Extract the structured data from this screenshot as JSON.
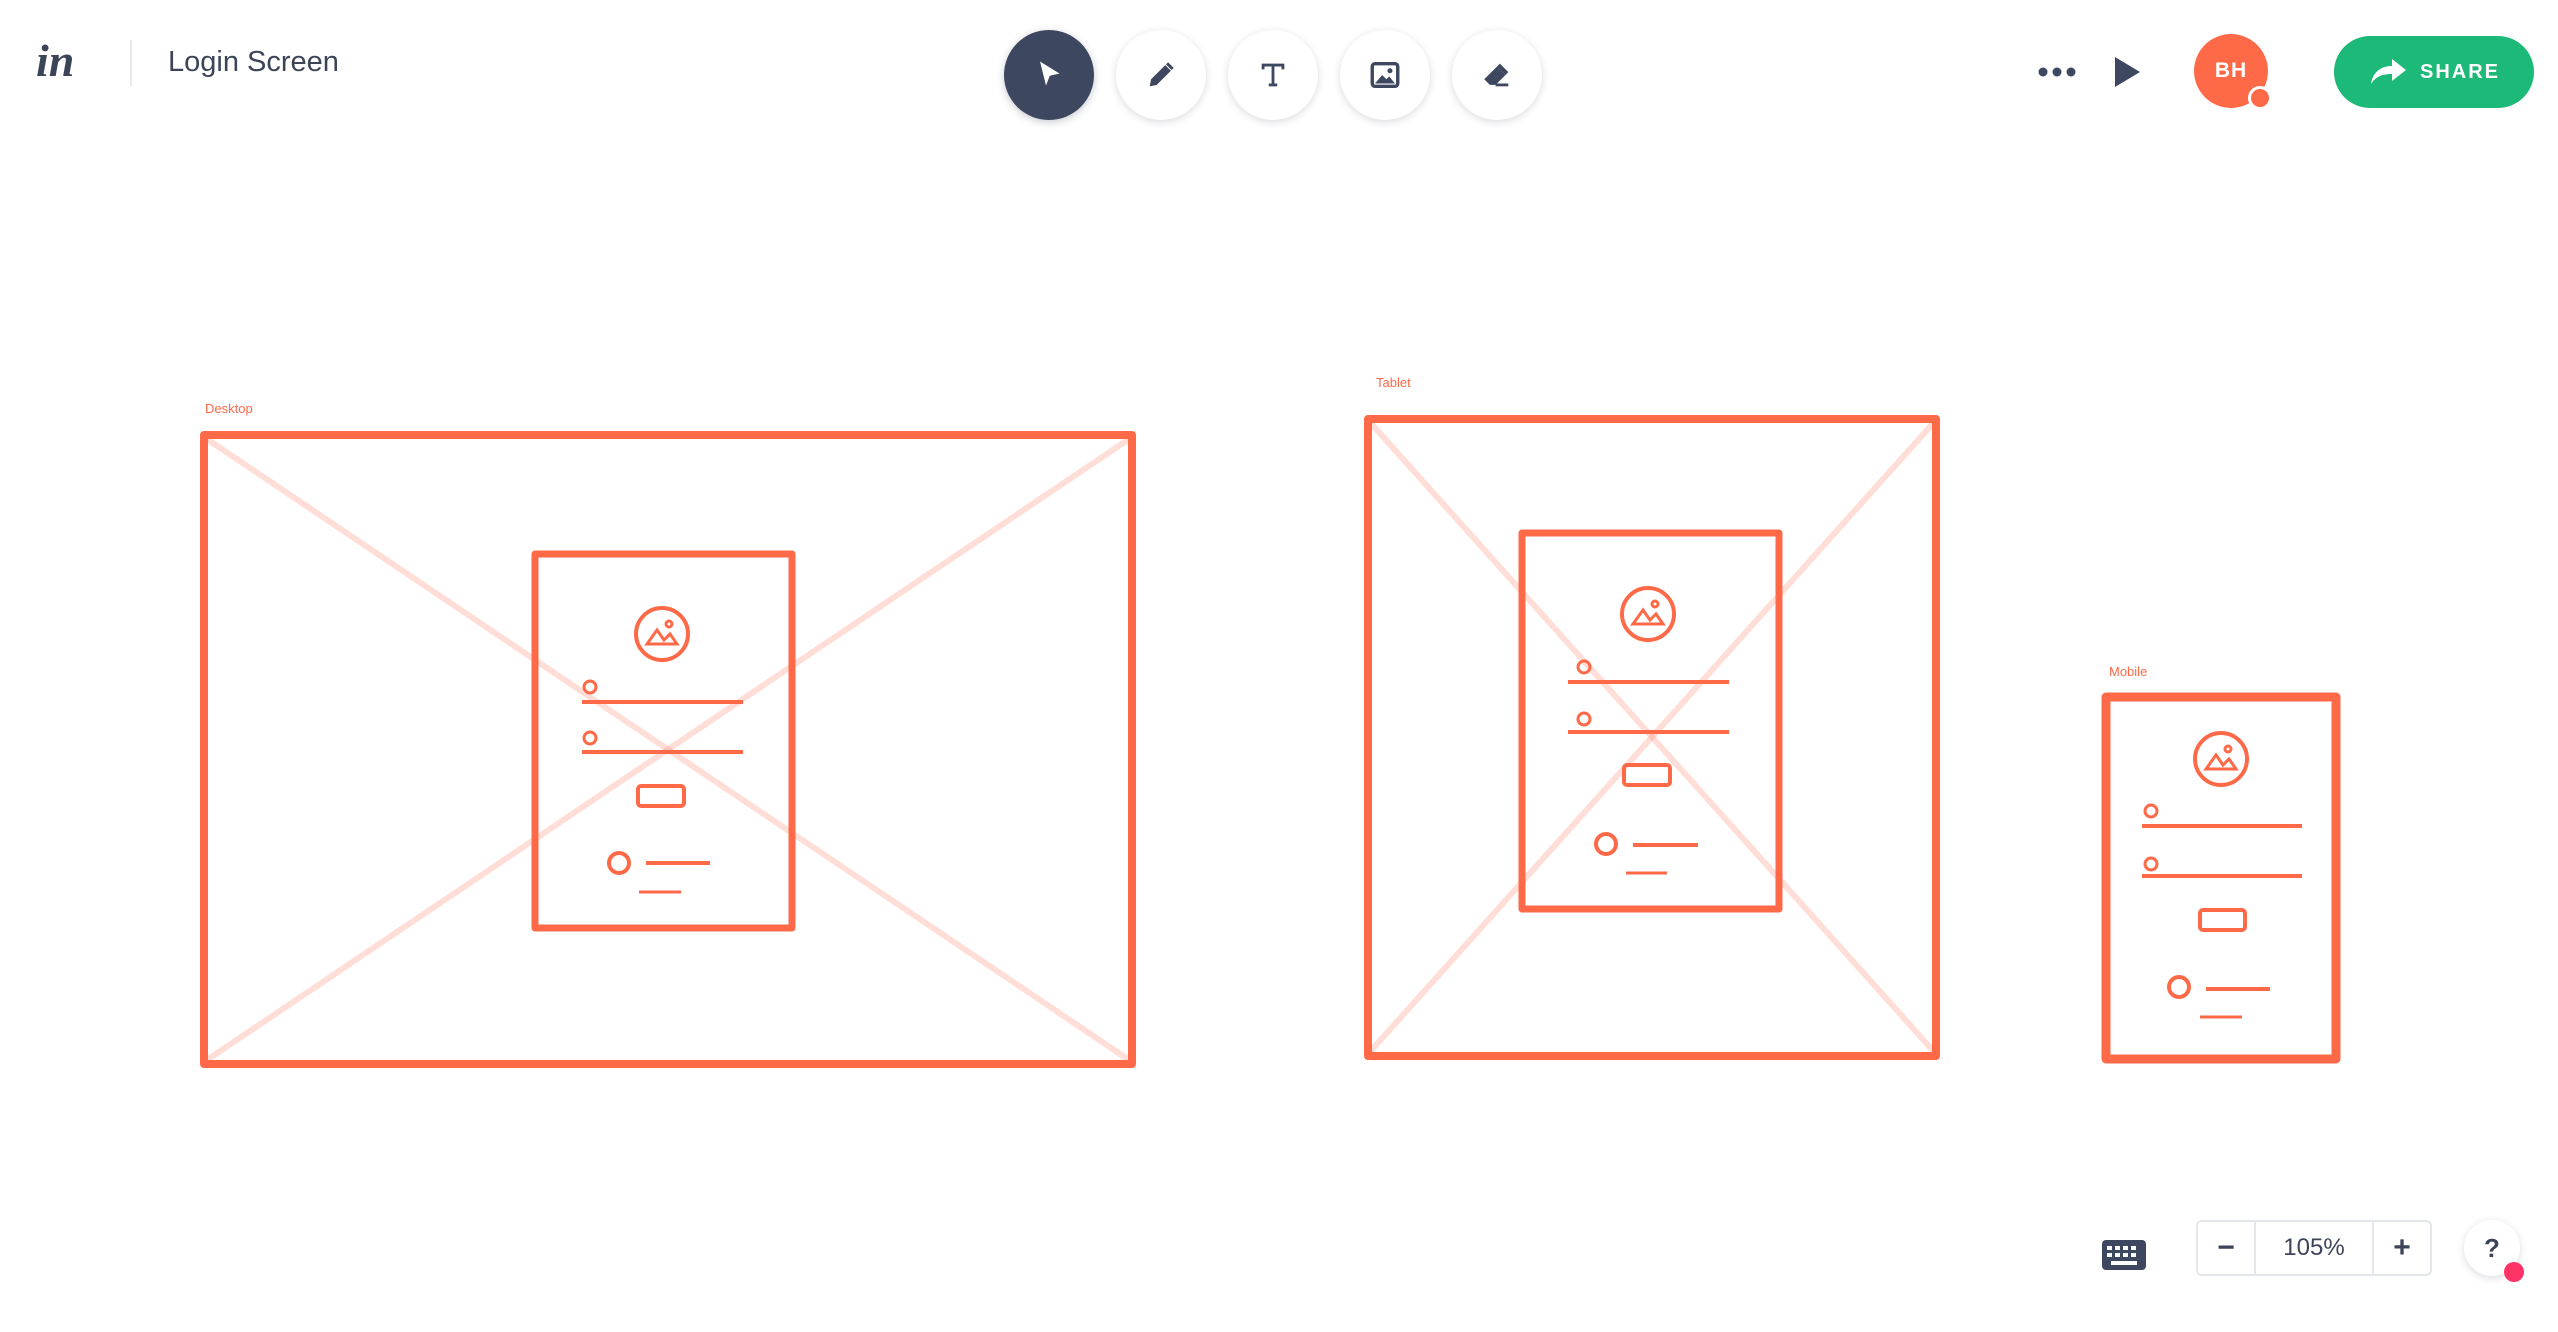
{
  "header": {
    "logo_text": "in",
    "title": "Login Screen"
  },
  "tools": [
    {
      "name": "select",
      "icon": "cursor-icon",
      "active": true
    },
    {
      "name": "pen",
      "icon": "pencil-icon",
      "active": false
    },
    {
      "name": "text",
      "icon": "text-icon",
      "active": false
    },
    {
      "name": "image",
      "icon": "image-icon",
      "active": false
    },
    {
      "name": "eraser",
      "icon": "eraser-icon",
      "active": false
    }
  ],
  "toolbar_right": {
    "more_icon": "ellipsis-icon",
    "play_icon": "play-icon",
    "avatar_initials": "BH",
    "share_label": "SHARE"
  },
  "canvas": {
    "frames": [
      {
        "label": "Desktop"
      },
      {
        "label": "Tablet"
      },
      {
        "label": "Mobile"
      }
    ]
  },
  "footer": {
    "keyboard_icon": "keyboard-icon",
    "zoom_out_label": "−",
    "zoom_level": "105%",
    "zoom_in_label": "+",
    "help_label": "?"
  },
  "colors": {
    "accent": "#fe6a48",
    "share": "#1db978",
    "dark": "#3e4760",
    "notification": "#ff3366"
  }
}
